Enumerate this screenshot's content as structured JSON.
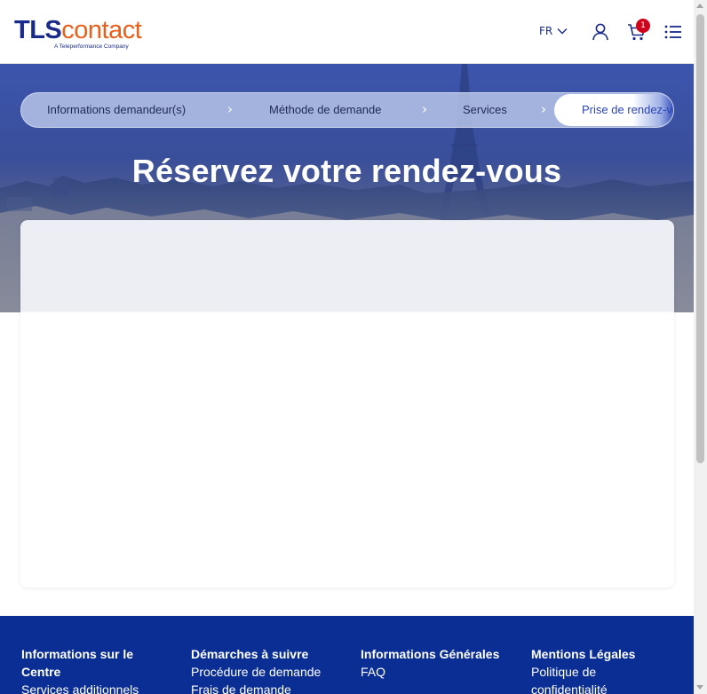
{
  "header": {
    "logo_primary": "TLS",
    "logo_secondary": "contact",
    "logo_tagline": "A Teleperformance Company",
    "language": "FR",
    "cart_count": "1",
    "icons": [
      "chevron-down-icon",
      "user-icon",
      "cart-icon",
      "menu-list-icon"
    ]
  },
  "stepper": {
    "steps": [
      {
        "label": "Informations demandeur(s)",
        "state": "done"
      },
      {
        "label": "Méthode de demande",
        "state": "done"
      },
      {
        "label": "Services",
        "state": "done"
      },
      {
        "label": "Prise de rendez-vous",
        "state": "active"
      }
    ],
    "separator": "›"
  },
  "main": {
    "title": "Réservez votre rendez-vous"
  },
  "footer": {
    "columns": [
      {
        "title": "Informations sur le Centre",
        "links": [
          "Services additionnels"
        ]
      },
      {
        "title": "Démarches à suivre",
        "links": [
          "Procédure de demande",
          "Frais de demande"
        ]
      },
      {
        "title": "Informations Générales",
        "links": [
          "FAQ"
        ]
      },
      {
        "title": "Mentions Légales",
        "links": [
          "Politique de confidentialité"
        ]
      }
    ]
  },
  "colors": {
    "brand_blue": "#1a2a8a",
    "brand_orange": "#e8601c",
    "badge_red": "#d0021b",
    "footer_blue": "#0a2e93",
    "active_step_text": "#2c45b8"
  }
}
